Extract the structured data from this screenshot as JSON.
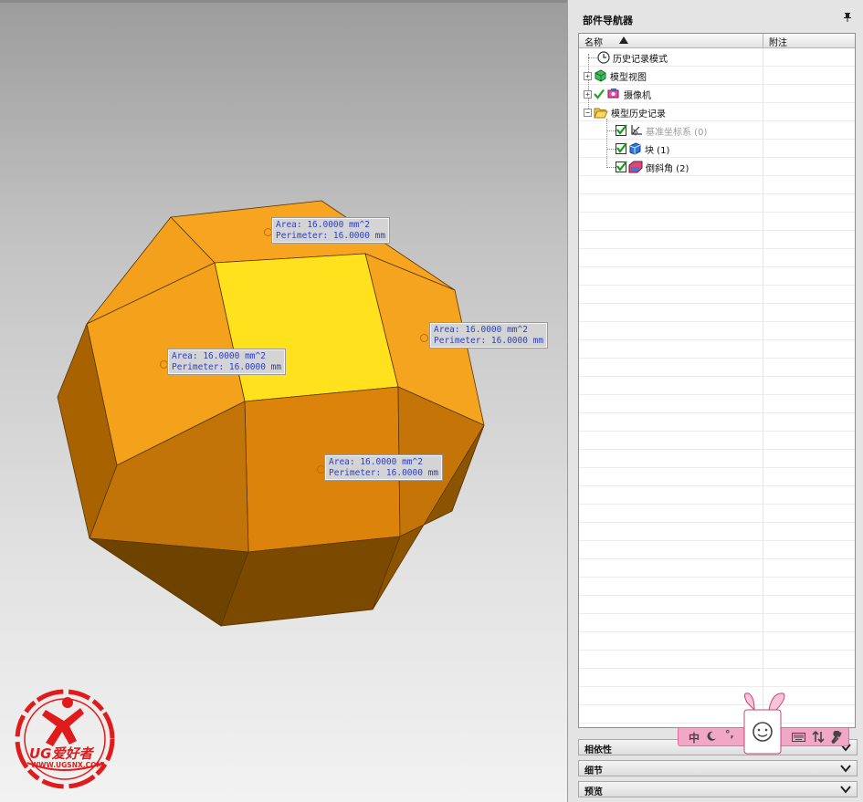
{
  "navigator": {
    "title": "部件导航器",
    "columns": {
      "name": "名称",
      "note": "附注"
    },
    "items": [
      {
        "label": "历史记录模式",
        "icon": "clock-icon"
      },
      {
        "label": "模型视图",
        "icon": "model-view-icon"
      },
      {
        "label": "摄像机",
        "icon": "camera-icon"
      },
      {
        "label": "模型历史记录",
        "icon": "folder-open-icon"
      },
      {
        "label": "基准坐标系 (0)",
        "icon": "datum-csys-icon",
        "checked": true,
        "suppressed_look": true
      },
      {
        "label": "块 (1)",
        "icon": "block-icon",
        "checked": true
      },
      {
        "label": "倒斜角 (2)",
        "icon": "chamfer-icon",
        "checked": true
      }
    ],
    "sections": [
      {
        "label": "相依性"
      },
      {
        "label": "细节"
      },
      {
        "label": "预览"
      }
    ]
  },
  "annotations": [
    {
      "area": "Area: 16.0000 mm^2",
      "perimeter": "Perimeter: 16.0000 mm"
    },
    {
      "area": "Area: 16.0000 mm^2",
      "perimeter": "Perimeter: 16.0000 mm"
    },
    {
      "area": "Area: 16.0000 mm^2",
      "perimeter": "Perimeter: 16.0000 mm"
    },
    {
      "area": "Area: 16.0000 mm^2",
      "perimeter": "Perimeter: 16.0000 mm"
    }
  ],
  "ime": {
    "mode": "中",
    "punct": "°,"
  },
  "logo": {
    "brand": "UG爱好者",
    "url": "WWW.UGSNX.COM"
  },
  "colors": {
    "face_top": "#FFE11E",
    "face_orange": "#F5A01E",
    "face_dark": "#D9820A",
    "face_shadow": "#7A4A00",
    "annotation_text": "#2B40C8",
    "ime_pink": "#F3A7C7"
  }
}
